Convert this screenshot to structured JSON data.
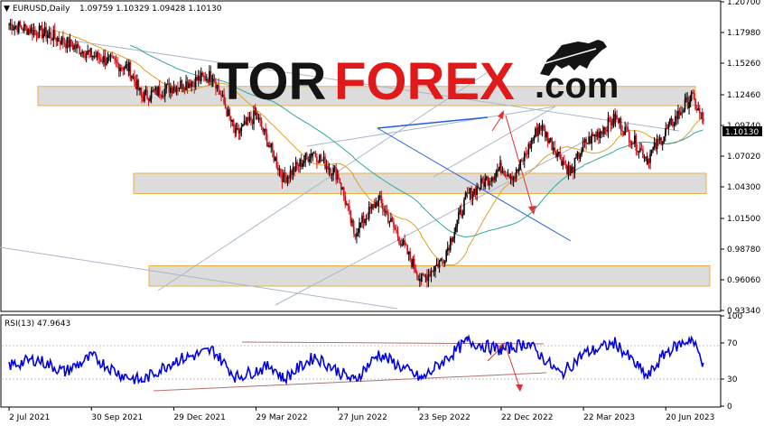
{
  "header": {
    "symbol": "EURUSD,Daily",
    "ohlc": "1.09759 1.10329 1.09428 1.10130",
    "rsi_label": "RSI(13) 47.9643"
  },
  "logo": {
    "part1": "TOR",
    "part2": "FOREX",
    "part3": ".com",
    "bull_icon": "bull-icon"
  },
  "colors": {
    "bull_candle": "#000000",
    "bear_candle": "#d0101a",
    "ma_fast": "#e0a020",
    "ma_slow": "#30a8a0",
    "rsi_line": "#0000e0",
    "zone_fill": "#dcdcdc",
    "zone_border": "#e8b040",
    "trend_blue": "#2060e0",
    "trend_red": "#e03030",
    "trend_grey": "#a8b8c8",
    "rsi_trend": "#b07070"
  },
  "chart_data": [
    {
      "type": "candlestick",
      "title": "EURUSD,Daily",
      "y_ticks": [
        "1.20700",
        "1.17980",
        "1.15260",
        "1.12460",
        "1.09740",
        "1.07020",
        "1.04300",
        "1.01500",
        "0.98780",
        "0.96060",
        "0.93340"
      ],
      "ylim": [
        0.9334,
        1.207
      ],
      "current_price": "1.10130",
      "x_ticks": [
        "2 Jul 2021",
        "30 Sep 2021",
        "29 Dec 2021",
        "29 Mar 2022",
        "27 Jun 2022",
        "23 Sep 2022",
        "22 Dec 2022",
        "22 Mar 2023",
        "20 Jun 2023"
      ],
      "series_points": [
        {
          "date": "2021-07-02",
          "close": 1.187
        },
        {
          "date": "2021-08-15",
          "close": 1.178
        },
        {
          "date": "2021-09-30",
          "close": 1.16
        },
        {
          "date": "2021-11-10",
          "close": 1.148
        },
        {
          "date": "2021-11-24",
          "close": 1.123
        },
        {
          "date": "2021-12-29",
          "close": 1.132
        },
        {
          "date": "2022-02-10",
          "close": 1.142
        },
        {
          "date": "2022-03-07",
          "close": 1.089
        },
        {
          "date": "2022-03-29",
          "close": 1.107
        },
        {
          "date": "2022-04-28",
          "close": 1.05
        },
        {
          "date": "2022-05-30",
          "close": 1.074
        },
        {
          "date": "2022-06-27",
          "close": 1.053
        },
        {
          "date": "2022-07-14",
          "close": 1.002
        },
        {
          "date": "2022-08-10",
          "close": 1.032
        },
        {
          "date": "2022-09-26",
          "close": 0.96
        },
        {
          "date": "2022-10-20",
          "close": 0.98
        },
        {
          "date": "2022-11-15",
          "close": 1.035
        },
        {
          "date": "2022-12-22",
          "close": 1.06
        },
        {
          "date": "2023-01-06",
          "close": 1.052
        },
        {
          "date": "2023-02-02",
          "close": 1.098
        },
        {
          "date": "2023-03-08",
          "close": 1.055
        },
        {
          "date": "2023-03-22",
          "close": 1.08
        },
        {
          "date": "2023-04-26",
          "close": 1.104
        },
        {
          "date": "2023-05-31",
          "close": 1.068
        },
        {
          "date": "2023-06-20",
          "close": 1.092
        },
        {
          "date": "2023-07-18",
          "close": 1.123
        },
        {
          "date": "2023-07-31",
          "close": 1.101
        }
      ],
      "support_resistance_zones": [
        {
          "low": 1.115,
          "high": 1.132
        },
        {
          "low": 1.037,
          "high": 1.055
        },
        {
          "low": 0.955,
          "high": 0.973
        }
      ]
    },
    {
      "type": "line",
      "title": "RSI(13) 47.9643",
      "y_ticks": [
        "100",
        "70",
        "30",
        "0"
      ],
      "ylim": [
        0,
        100
      ],
      "x_ticks": [
        "2 Jul 2021",
        "30 Sep 2021",
        "29 Dec 2021",
        "29 Mar 2022",
        "27 Jun 2022",
        "23 Sep 2022",
        "22 Dec 2022",
        "22 Mar 2023",
        "20 Jun 2023"
      ],
      "series_points": [
        {
          "date": "2021-07-02",
          "value": 45
        },
        {
          "date": "2021-08-01",
          "value": 52
        },
        {
          "date": "2021-09-01",
          "value": 38
        },
        {
          "date": "2021-10-01",
          "value": 55
        },
        {
          "date": "2021-11-01",
          "value": 35
        },
        {
          "date": "2021-11-24",
          "value": 28
        },
        {
          "date": "2021-12-29",
          "value": 50
        },
        {
          "date": "2022-02-10",
          "value": 62
        },
        {
          "date": "2022-03-07",
          "value": 32
        },
        {
          "date": "2022-04-15",
          "value": 45
        },
        {
          "date": "2022-04-28",
          "value": 30
        },
        {
          "date": "2022-06-01",
          "value": 55
        },
        {
          "date": "2022-07-14",
          "value": 28
        },
        {
          "date": "2022-08-10",
          "value": 58
        },
        {
          "date": "2022-09-26",
          "value": 30
        },
        {
          "date": "2022-11-15",
          "value": 72
        },
        {
          "date": "2022-12-22",
          "value": 62
        },
        {
          "date": "2023-01-20",
          "value": 70
        },
        {
          "date": "2023-02-25",
          "value": 35
        },
        {
          "date": "2023-03-22",
          "value": 58
        },
        {
          "date": "2023-04-26",
          "value": 70
        },
        {
          "date": "2023-05-31",
          "value": 32
        },
        {
          "date": "2023-06-20",
          "value": 60
        },
        {
          "date": "2023-07-18",
          "value": 75
        },
        {
          "date": "2023-07-31",
          "value": 48
        }
      ],
      "levels": [
        70,
        30
      ]
    }
  ]
}
